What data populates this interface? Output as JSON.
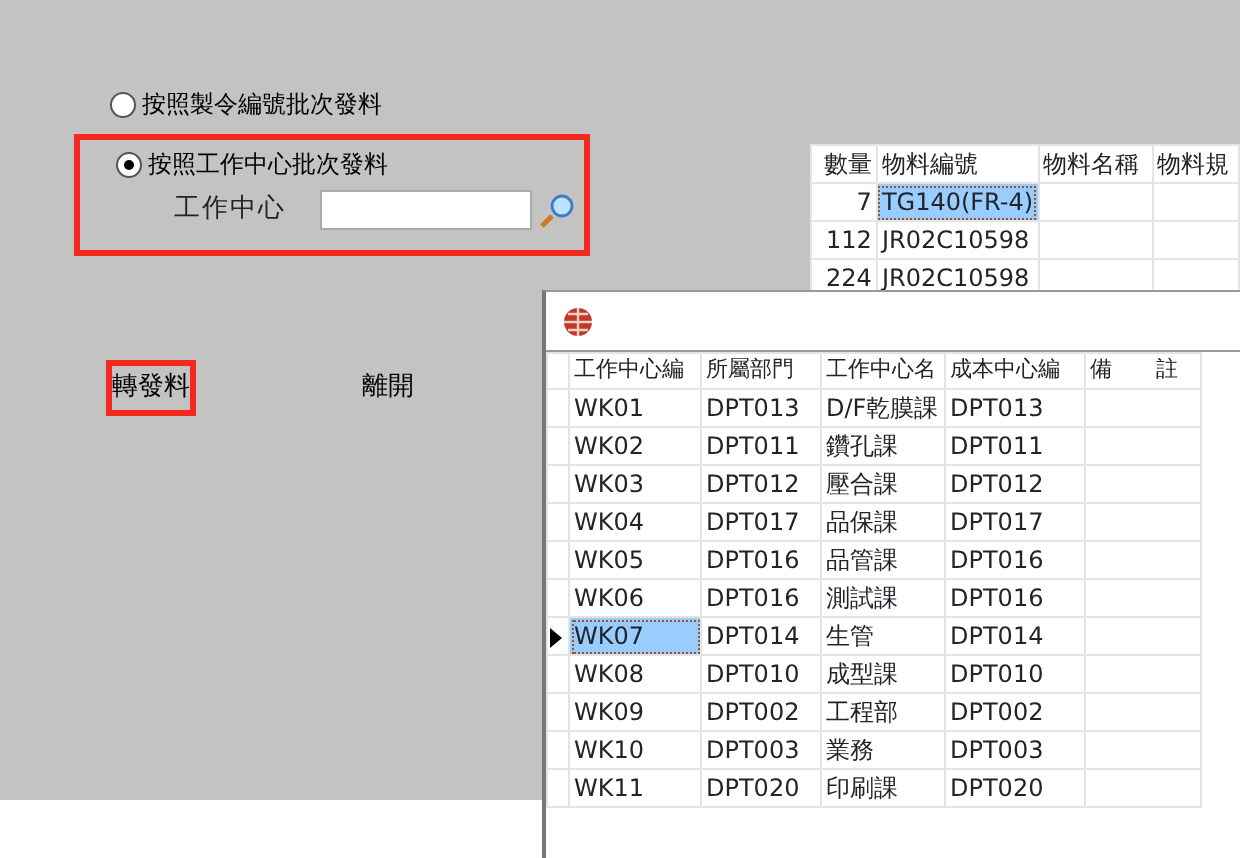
{
  "issue_form": {
    "options": [
      {
        "label": "按照製令編號批次發料",
        "selected": false,
        "highlighted": false
      },
      {
        "label": "按照工作中心批次發料",
        "selected": true,
        "highlighted": true
      }
    ],
    "work_center_field": {
      "label": "工作中心"
    },
    "buttons": [
      {
        "label": "轉發料",
        "highlighted": true
      },
      {
        "label": "離開",
        "highlighted": false
      }
    ]
  },
  "material_table": {
    "columns": [
      "數量",
      "物料編號",
      "物料名稱",
      "物料規"
    ],
    "rows": [
      {
        "cells": [
          "7",
          "TG140(FR-4)"
        ],
        "selected": true
      },
      {
        "cells": [
          "112",
          "JR02C10598"
        ],
        "selected": false
      },
      {
        "cells": [
          "224",
          "JR02C10598"
        ],
        "selected": false
      }
    ]
  },
  "lookup_window": {
    "columns": [
      "工作中心編",
      "所屬部門",
      "工作中心名",
      "成本中心編",
      "備　　註"
    ],
    "rows": [
      {
        "cells": [
          "WK01",
          "DPT013",
          "D/F乾膜課",
          "DPT013"
        ],
        "current": false
      },
      {
        "cells": [
          "WK02",
          "DPT011",
          "鑽孔課",
          "DPT011"
        ],
        "current": false
      },
      {
        "cells": [
          "WK03",
          "DPT012",
          "壓合課",
          "DPT012"
        ],
        "current": false
      },
      {
        "cells": [
          "WK04",
          "DPT017",
          "品保課",
          "DPT017"
        ],
        "current": false
      },
      {
        "cells": [
          "WK05",
          "DPT016",
          "品管課",
          "DPT016"
        ],
        "current": false
      },
      {
        "cells": [
          "WK06",
          "DPT016",
          "測試課",
          "DPT016"
        ],
        "current": false
      },
      {
        "cells": [
          "WK07",
          "DPT014",
          "生管",
          "DPT014"
        ],
        "current": true
      },
      {
        "cells": [
          "WK08",
          "DPT010",
          "成型課",
          "DPT010"
        ],
        "current": false
      },
      {
        "cells": [
          "WK09",
          "DPT002",
          "工程部",
          "DPT002"
        ],
        "current": false
      },
      {
        "cells": [
          "WK10",
          "DPT003",
          "業務",
          "DPT003"
        ],
        "current": false
      },
      {
        "cells": [
          "WK11",
          "DPT020",
          "印刷課",
          "DPT020"
        ],
        "current": false
      }
    ]
  }
}
